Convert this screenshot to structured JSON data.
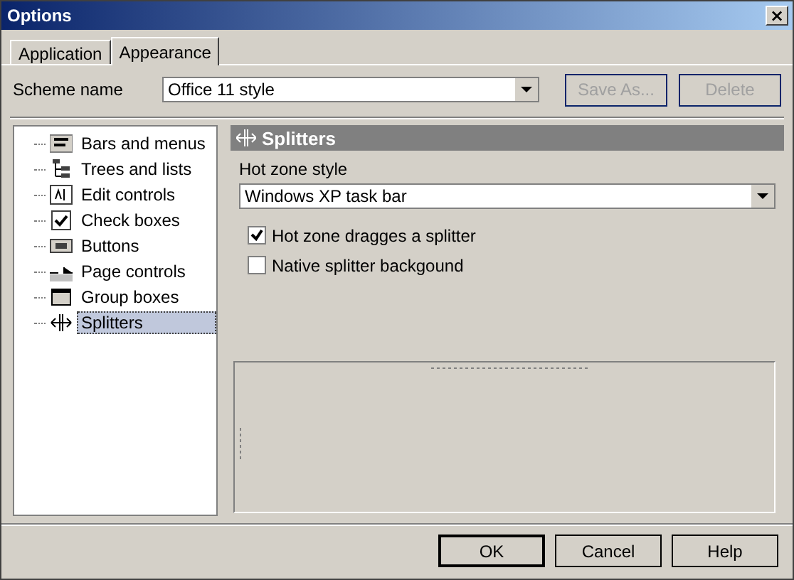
{
  "window": {
    "title": "Options",
    "close": "×"
  },
  "tabs": [
    {
      "label": "Application",
      "selected": false
    },
    {
      "label": "Appearance",
      "selected": true
    }
  ],
  "scheme": {
    "label": "Scheme name",
    "value": "Office 11 style",
    "buttons": [
      {
        "label": "Save As...",
        "disabled": true
      },
      {
        "label": "Delete",
        "disabled": true
      }
    ]
  },
  "tree": {
    "items": [
      {
        "label": "Bars and menus",
        "selected": false
      },
      {
        "label": "Trees and lists",
        "selected": false
      },
      {
        "label": "Edit controls",
        "selected": false
      },
      {
        "label": "Check boxes",
        "selected": false
      },
      {
        "label": "Buttons",
        "selected": false
      },
      {
        "label": "Page controls",
        "selected": false
      },
      {
        "label": "Group boxes",
        "selected": false
      },
      {
        "label": "Splitters",
        "selected": true
      }
    ]
  },
  "panel": {
    "title": "Splitters",
    "field_label": "Hot zone style",
    "field_value": "Windows XP task bar",
    "checkboxes": [
      {
        "label": "Hot zone dragges a splitter",
        "checked": true
      },
      {
        "label": "Native splitter backgound",
        "checked": false
      }
    ]
  },
  "buttons": [
    {
      "label": "OK",
      "default": true
    },
    {
      "label": "Cancel",
      "default": false
    },
    {
      "label": "Help",
      "default": false
    }
  ]
}
